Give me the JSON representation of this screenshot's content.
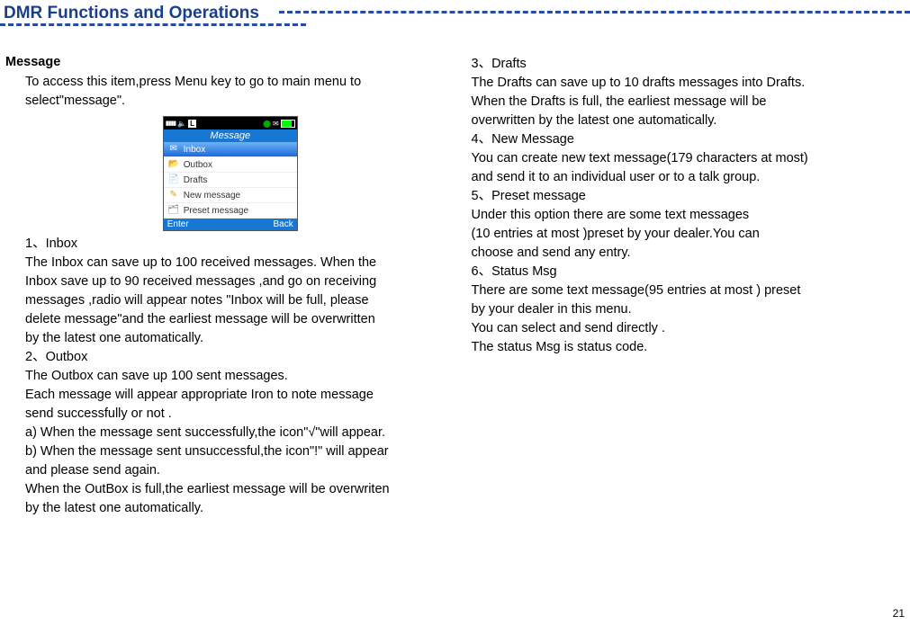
{
  "header": {
    "title": "DMR Functions and Operations"
  },
  "left": {
    "section": "Message",
    "intro1": "To access this item,press Menu key to go to main menu to",
    "intro2": "select\"message\".",
    "screenshot": {
      "title": "Message",
      "menu": [
        {
          "label": "Inbox",
          "icon": "✉",
          "selected": true
        },
        {
          "label": "Outbox",
          "icon": "📂",
          "selected": false
        },
        {
          "label": "Drafts",
          "icon": "📄",
          "selected": false
        },
        {
          "label": "New message",
          "icon": "✎",
          "selected": false
        },
        {
          "label": "Preset message",
          "icon": "🗂",
          "selected": false
        }
      ],
      "softkey_left": "Enter",
      "softkey_right": "Back",
      "status_L": "L"
    },
    "h1": "1、Inbox",
    "inbox1": "The Inbox can save up to 100 received messages. When the",
    "inbox2": "Inbox save up to 90 received messages ,and go on receiving",
    "inbox3": "messages ,radio will appear notes \"Inbox will be full, please",
    "inbox4": "delete message\"and the earliest message will be overwritten",
    "inbox5": "by the latest one automatically.",
    "h2": "2、Outbox",
    "outbox1": "The Outbox can save up 100  sent messages.",
    "outbox2": "Each message will appear appropriate Iron to note message",
    "outbox3": "send successfully or not .",
    "outbox4": "a) When the message sent successfully,the icon\"√\"will appear.",
    "outbox5": "b) When the message sent unsuccessful,the icon\"!\" will appear",
    "outbox6": "and please send again.",
    "outbox7": "When the OutBox is full,the earliest message will be overwriten",
    "outbox8": "by the latest one automatically."
  },
  "right": {
    "h3": "3、Drafts",
    "drafts1": "The Drafts can save up to 10  drafts messages into Drafts.",
    "drafts2": "When the Drafts is full, the earliest message will be",
    "drafts3": "overwritten by the latest one automatically.",
    "h4": "4、New Message",
    "new1": "You can create new text message(179 characters at most)",
    "new2": "and send it to an individual user or to a talk group.",
    "h5": "5、Preset  message",
    "preset1": "Under this option there are some text messages",
    "preset2": "(10 entries at most )preset by your dealer.You can",
    "preset3": "choose and send any entry.",
    "h6": "6、Status Msg",
    "status1": "There are some text message(95 entries at most ) preset",
    "status2": "by your dealer in this menu.",
    "status3": "You can select and send directly  .",
    "status4": "The status Msg is status code."
  },
  "page": "21"
}
